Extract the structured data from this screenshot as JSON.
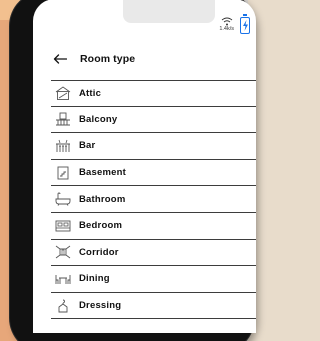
{
  "status_bar": {
    "network_speed": "1.4k/s",
    "wifi_icon": "wifi-icon",
    "battery_icon": "battery-charging-icon",
    "battery_color": "#1a73e8"
  },
  "header": {
    "back_icon": "arrow-left-icon",
    "title": "Room type"
  },
  "room_types": [
    {
      "label": "Attic",
      "icon": "attic-icon"
    },
    {
      "label": "Balcony",
      "icon": "balcony-icon"
    },
    {
      "label": "Bar",
      "icon": "bar-icon"
    },
    {
      "label": "Basement",
      "icon": "basement-icon"
    },
    {
      "label": "Bathroom",
      "icon": "bathroom-icon"
    },
    {
      "label": "Bedroom",
      "icon": "bedroom-icon"
    },
    {
      "label": "Corridor",
      "icon": "corridor-icon"
    },
    {
      "label": "Dining",
      "icon": "dining-icon"
    },
    {
      "label": "Dressing",
      "icon": "dressing-icon"
    }
  ]
}
